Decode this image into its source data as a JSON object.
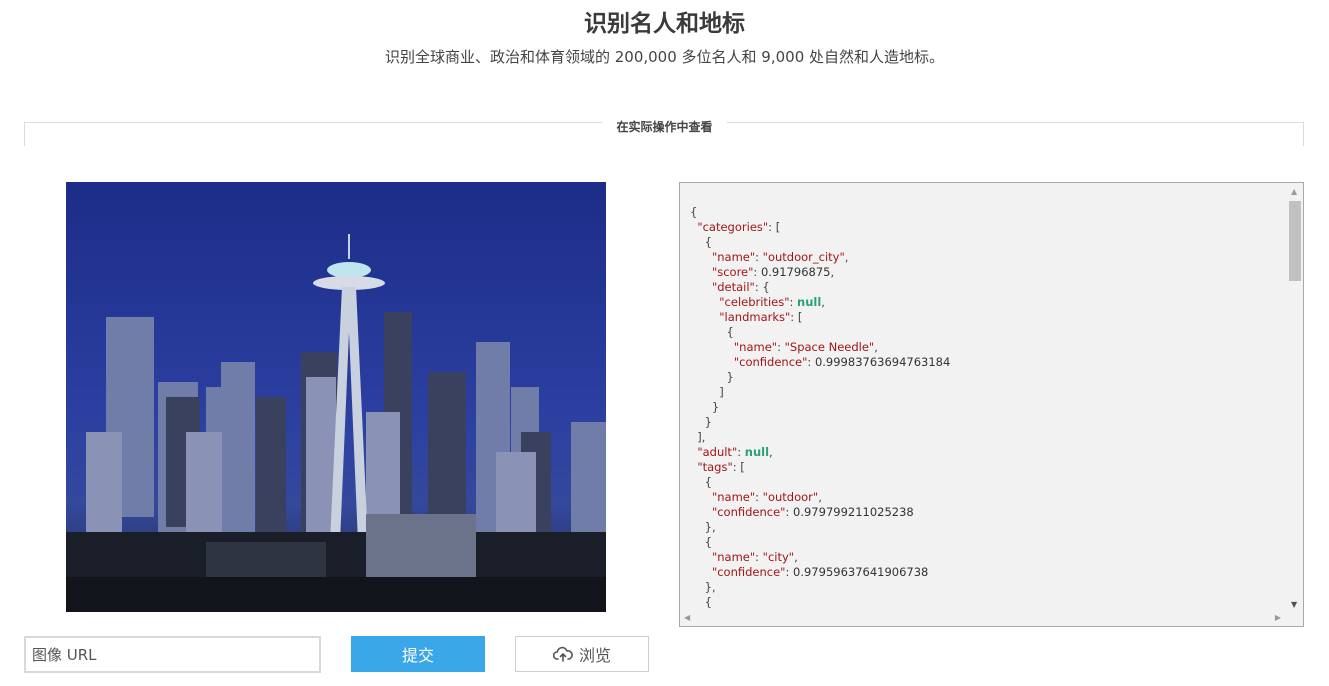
{
  "header": {
    "title": "识别名人和地标",
    "subtitle": "识别全球商业、政治和体育领域的 200,000 多位名人和 9,000 处自然和人造地标。"
  },
  "demo": {
    "section_title": "在实际操作中查看"
  },
  "image": {
    "subject": "Seattle skyline at dusk with the Space Needle"
  },
  "json_output": {
    "lines": [
      [
        {
          "t": "p",
          "v": "{"
        }
      ],
      [
        {
          "t": "p",
          "v": "  "
        },
        {
          "t": "k",
          "v": "\"categories\""
        },
        {
          "t": "p",
          "v": ": ["
        }
      ],
      [
        {
          "t": "p",
          "v": "    {"
        }
      ],
      [
        {
          "t": "p",
          "v": "      "
        },
        {
          "t": "k",
          "v": "\"name\""
        },
        {
          "t": "p",
          "v": ": "
        },
        {
          "t": "s",
          "v": "\"outdoor_city\""
        },
        {
          "t": "p",
          "v": ","
        }
      ],
      [
        {
          "t": "p",
          "v": "      "
        },
        {
          "t": "k",
          "v": "\"score\""
        },
        {
          "t": "p",
          "v": ": "
        },
        {
          "t": "n",
          "v": "0.91796875"
        },
        {
          "t": "p",
          "v": ","
        }
      ],
      [
        {
          "t": "p",
          "v": "      "
        },
        {
          "t": "k",
          "v": "\"detail\""
        },
        {
          "t": "p",
          "v": ": {"
        }
      ],
      [
        {
          "t": "p",
          "v": "        "
        },
        {
          "t": "k",
          "v": "\"celebrities\""
        },
        {
          "t": "p",
          "v": ": "
        },
        {
          "t": "nl",
          "v": "null"
        },
        {
          "t": "p",
          "v": ","
        }
      ],
      [
        {
          "t": "p",
          "v": "        "
        },
        {
          "t": "k",
          "v": "\"landmarks\""
        },
        {
          "t": "p",
          "v": ": ["
        }
      ],
      [
        {
          "t": "p",
          "v": "          {"
        }
      ],
      [
        {
          "t": "p",
          "v": "            "
        },
        {
          "t": "k",
          "v": "\"name\""
        },
        {
          "t": "p",
          "v": ": "
        },
        {
          "t": "s",
          "v": "\"Space Needle\""
        },
        {
          "t": "p",
          "v": ","
        }
      ],
      [
        {
          "t": "p",
          "v": "            "
        },
        {
          "t": "k",
          "v": "\"confidence\""
        },
        {
          "t": "p",
          "v": ": "
        },
        {
          "t": "n",
          "v": "0.99983763694763184"
        }
      ],
      [
        {
          "t": "p",
          "v": "          }"
        }
      ],
      [
        {
          "t": "p",
          "v": "        ]"
        }
      ],
      [
        {
          "t": "p",
          "v": "      }"
        }
      ],
      [
        {
          "t": "p",
          "v": "    }"
        }
      ],
      [
        {
          "t": "p",
          "v": "  ],"
        }
      ],
      [
        {
          "t": "p",
          "v": "  "
        },
        {
          "t": "k",
          "v": "\"adult\""
        },
        {
          "t": "p",
          "v": ": "
        },
        {
          "t": "nl",
          "v": "null"
        },
        {
          "t": "p",
          "v": ","
        }
      ],
      [
        {
          "t": "p",
          "v": "  "
        },
        {
          "t": "k",
          "v": "\"tags\""
        },
        {
          "t": "p",
          "v": ": ["
        }
      ],
      [
        {
          "t": "p",
          "v": "    {"
        }
      ],
      [
        {
          "t": "p",
          "v": "      "
        },
        {
          "t": "k",
          "v": "\"name\""
        },
        {
          "t": "p",
          "v": ": "
        },
        {
          "t": "s",
          "v": "\"outdoor\""
        },
        {
          "t": "p",
          "v": ","
        }
      ],
      [
        {
          "t": "p",
          "v": "      "
        },
        {
          "t": "k",
          "v": "\"confidence\""
        },
        {
          "t": "p",
          "v": ": "
        },
        {
          "t": "n",
          "v": "0.979799211025238"
        }
      ],
      [
        {
          "t": "p",
          "v": "    },"
        }
      ],
      [
        {
          "t": "p",
          "v": "    {"
        }
      ],
      [
        {
          "t": "p",
          "v": "      "
        },
        {
          "t": "k",
          "v": "\"name\""
        },
        {
          "t": "p",
          "v": ": "
        },
        {
          "t": "s",
          "v": "\"city\""
        },
        {
          "t": "p",
          "v": ","
        }
      ],
      [
        {
          "t": "p",
          "v": "      "
        },
        {
          "t": "k",
          "v": "\"confidence\""
        },
        {
          "t": "p",
          "v": ": "
        },
        {
          "t": "n",
          "v": "0.97959637641906738"
        }
      ],
      [
        {
          "t": "p",
          "v": "    },"
        }
      ],
      [
        {
          "t": "p",
          "v": "    {"
        }
      ]
    ]
  },
  "controls": {
    "url_placeholder": "图像 URL",
    "url_value": "",
    "submit_label": "提交",
    "browse_label": "浏览",
    "browse_icon": "cloud-upload-icon"
  },
  "colors": {
    "accent": "#3aa7e8",
    "json_key": "#a31515",
    "json_null": "#2aa275"
  }
}
